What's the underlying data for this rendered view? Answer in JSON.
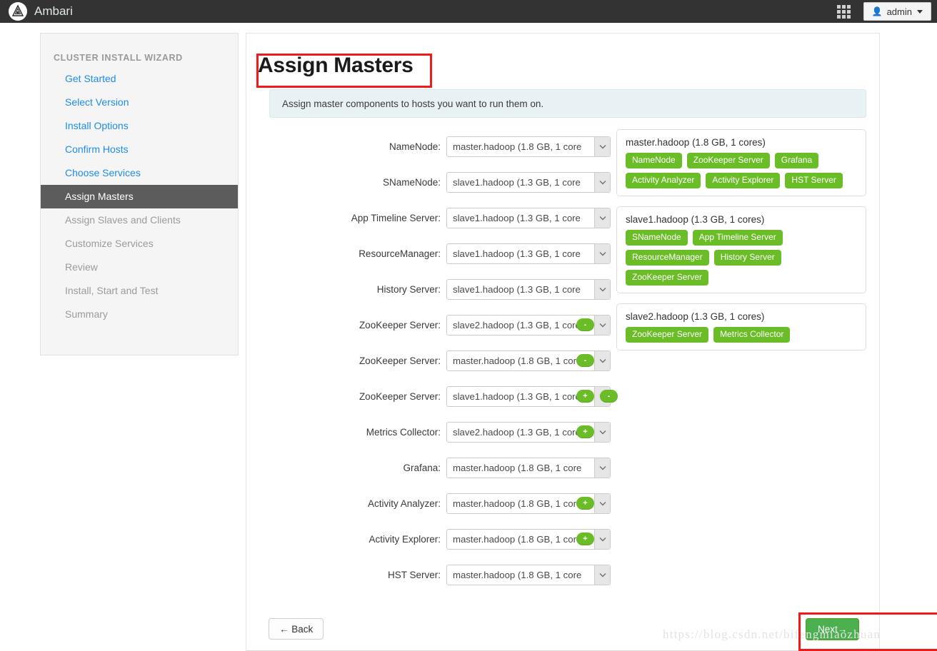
{
  "navbar": {
    "brand": "Ambari",
    "logo_icon": "ambari-logo-icon",
    "grid_icon": "apps-grid-icon",
    "user_icon": "user-icon",
    "user_label": "admin",
    "caret_icon": "caret-down-icon"
  },
  "sidebar": {
    "title": "CLUSTER INSTALL WIZARD",
    "items": [
      {
        "label": "Get Started",
        "state": "done"
      },
      {
        "label": "Select Version",
        "state": "done"
      },
      {
        "label": "Install Options",
        "state": "done"
      },
      {
        "label": "Confirm Hosts",
        "state": "done"
      },
      {
        "label": "Choose Services",
        "state": "done"
      },
      {
        "label": "Assign Masters",
        "state": "active"
      },
      {
        "label": "Assign Slaves and Clients",
        "state": "pending"
      },
      {
        "label": "Customize Services",
        "state": "pending"
      },
      {
        "label": "Review",
        "state": "pending"
      },
      {
        "label": "Install, Start and Test",
        "state": "pending"
      },
      {
        "label": "Summary",
        "state": "pending"
      }
    ]
  },
  "main": {
    "title": "Assign Masters",
    "alert": "Assign master components to hosts you want to run them on.",
    "assignments": [
      {
        "label": "NameNode:",
        "value": "master.hadoop (1.8 GB, 1 core",
        "add": false,
        "remove": false
      },
      {
        "label": "SNameNode:",
        "value": "slave1.hadoop (1.3 GB, 1 core",
        "add": false,
        "remove": false
      },
      {
        "label": "App Timeline Server:",
        "value": "slave1.hadoop (1.3 GB, 1 core",
        "add": false,
        "remove": false
      },
      {
        "label": "ResourceManager:",
        "value": "slave1.hadoop (1.3 GB, 1 core",
        "add": false,
        "remove": false
      },
      {
        "label": "History Server:",
        "value": "slave1.hadoop (1.3 GB, 1 core",
        "add": false,
        "remove": false
      },
      {
        "label": "ZooKeeper Server:",
        "value": "slave2.hadoop (1.3 GB, 1 core",
        "add": false,
        "remove": true
      },
      {
        "label": "ZooKeeper Server:",
        "value": "master.hadoop (1.8 GB, 1 core",
        "add": false,
        "remove": true
      },
      {
        "label": "ZooKeeper Server:",
        "value": "slave1.hadoop (1.3 GB, 1 core",
        "add": true,
        "remove": true
      },
      {
        "label": "Metrics Collector:",
        "value": "slave2.hadoop (1.3 GB, 1 core",
        "add": true,
        "remove": false
      },
      {
        "label": "Grafana:",
        "value": "master.hadoop (1.8 GB, 1 core",
        "add": false,
        "remove": false
      },
      {
        "label": "Activity Analyzer:",
        "value": "master.hadoop (1.8 GB, 1 core",
        "add": true,
        "remove": false
      },
      {
        "label": "Activity Explorer:",
        "value": "master.hadoop (1.8 GB, 1 core",
        "add": true,
        "remove": false
      },
      {
        "label": "HST Server:",
        "value": "master.hadoop (1.8 GB, 1 core",
        "add": false,
        "remove": false
      }
    ],
    "hosts": [
      {
        "name": "master.hadoop (1.8 GB, 1 cores)",
        "components": [
          "NameNode",
          "ZooKeeper Server",
          "Grafana",
          "Activity Analyzer",
          "Activity Explorer",
          "HST Server"
        ]
      },
      {
        "name": "slave1.hadoop (1.3 GB, 1 cores)",
        "components": [
          "SNameNode",
          "App Timeline Server",
          "ResourceManager",
          "History Server",
          "ZooKeeper Server"
        ]
      },
      {
        "name": "slave2.hadoop (1.3 GB, 1 cores)",
        "components": [
          "ZooKeeper Server",
          "Metrics Collector"
        ]
      }
    ],
    "add_symbol": "+",
    "remove_symbol": "-",
    "back_label": "← Back",
    "next_label": "Next→"
  },
  "watermark": "https://blog.csdn.net/bifengmiaozhuan",
  "colors": {
    "navbar_bg": "#333333",
    "accent_green": "#6abd26",
    "next_green": "#4caf50",
    "link_blue": "#1f8ceb",
    "active_gray": "#5c5c5c",
    "annotation_red": "#f01a1a",
    "info_bg": "#e8f1f4"
  }
}
